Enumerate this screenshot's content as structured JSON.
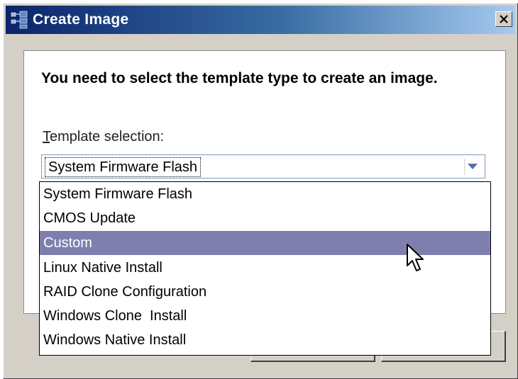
{
  "window": {
    "title": "Create Image",
    "close_label": "✕"
  },
  "content": {
    "heading": "You need to select the template type to create an image.",
    "selection_label": "Template selection:"
  },
  "combo": {
    "selected_value": "System Firmware Flash"
  },
  "dropdown": {
    "items": [
      {
        "label": "System Firmware Flash",
        "selected": false
      },
      {
        "label": "CMOS Update",
        "selected": false
      },
      {
        "label": "Custom",
        "selected": true
      },
      {
        "label": "Linux Native Install",
        "selected": false
      },
      {
        "label": "RAID Clone Configuration",
        "selected": false
      },
      {
        "label": "Windows Clone  Install",
        "selected": false
      },
      {
        "label": "Windows Native Install",
        "selected": false
      }
    ]
  },
  "colors": {
    "titlebar_start": "#0a246a",
    "titlebar_end": "#a6caf0",
    "selection_highlight": "#7f7faf",
    "dialog_face": "#d4d0c8"
  },
  "icons": {
    "app": "network-nodes-icon",
    "close": "close-icon",
    "combo_arrow": "chevron-down-icon",
    "cursor": "mouse-pointer-icon"
  }
}
